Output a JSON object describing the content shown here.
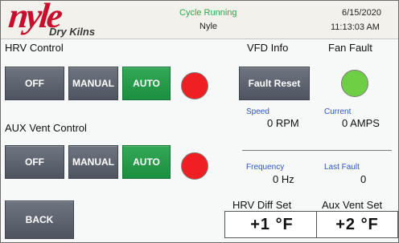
{
  "header": {
    "logo_main": "nyle",
    "logo_sub": "Dry Kilns",
    "status": "Cycle Running",
    "sub_status": "Nyle",
    "date": "6/15/2020",
    "time": "11:13:03 AM"
  },
  "hrv": {
    "title": "HRV Control",
    "off_label": "OFF",
    "manual_label": "MANUAL",
    "auto_label": "AUTO",
    "selected": "AUTO",
    "indicator_color": "#ee2024"
  },
  "aux": {
    "title": "AUX Vent Control",
    "off_label": "OFF",
    "manual_label": "MANUAL",
    "auto_label": "AUTO",
    "selected": "AUTO",
    "indicator_color": "#ee2024"
  },
  "vfd": {
    "title": "VFD Info",
    "fault_title": "Fan Fault",
    "fault_reset_label": "Fault Reset",
    "fault_indicator_color": "#6fcf44",
    "speed_label": "Speed",
    "speed_value": "0 RPM",
    "current_label": "Current",
    "current_value": "0 AMPS",
    "frequency_label": "Frequency",
    "frequency_value": "0 Hz",
    "last_fault_label": "Last Fault",
    "last_fault_value": "0"
  },
  "setpoints": {
    "hrv_diff_label": "HRV Diff Set",
    "hrv_diff_value": "+1 °F",
    "aux_vent_label": "Aux Vent Set",
    "aux_vent_value": "+2 °F"
  },
  "back_label": "BACK",
  "colors": {
    "brand": "#c8102e",
    "active_button": "#1d8f40",
    "inactive_button": "#4f5560",
    "info_label": "#2b55c8"
  }
}
